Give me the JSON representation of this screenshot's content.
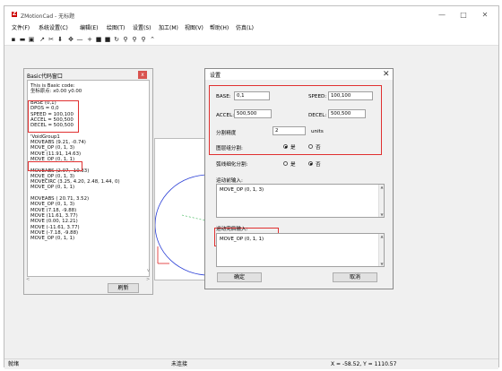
{
  "window": {
    "title": "ZMotionCad - 无标题",
    "minimize": "—",
    "maximize": "□",
    "close": "✕"
  },
  "menu": [
    "文件(F)",
    "系统设置(C)",
    "编辑(E)",
    "绘图(T)",
    "设置(S)",
    "加工(M)",
    "视图(V)",
    "帮助(H)",
    "仿真(L)"
  ],
  "toolbar_icons": [
    "new-file-icon",
    "open-folder-icon",
    "save-icon",
    "cursor-icon",
    "scissors-icon",
    "download-icon",
    "move-icon",
    "line-icon",
    "crosshair-icon",
    "lock-icon",
    "unlock-icon",
    "rotate-icon",
    "zoom-in-icon",
    "zoom-out-icon",
    "zoom-fit-icon",
    "pan-icon"
  ],
  "basic_panel": {
    "title": "Basic代码窗口",
    "close": "x",
    "lines": [
      "This is Basic code:",
      "坐标原点: x0.00 y0.00",
      "",
      "BASE (0,1)",
      "DPOS = 0,0",
      "SPEED = 100,100",
      "ACCEL = 500,500",
      "DECEL = 500,500",
      "",
      "'VoidGroup1",
      "MOVEABS (9.21, -0.74)",
      "MOVE_OP (0, 1, 3)",
      "MOVE (11.91, 14.63)",
      "MOVE_OP (0, 1, 1)",
      "",
      "MOVEABS (2.07, -10.33)",
      "MOVE_OP (0, 1, 3)",
      "MOVECIRC (3.25, 4.20, 2.48, 1.44, 0)",
      "MOVE_OP (0, 1, 1)",
      "",
      "MOVEABS ( 20.71, 3.52)",
      "MOVE_OP (0, 1, 3)",
      "MOVE (7.18, -9.88)",
      "MOVE (11.61, 3.77)",
      "MOVE (0.00, 12.21)",
      "MOVE (-11.61, 3.77)",
      "MOVE (-7.18, -9.88)",
      "MOVE_OP (0, 1, 1)"
    ],
    "button": "刷新"
  },
  "dialog": {
    "title": "设置",
    "close": "✕",
    "base_label": "BASE:",
    "base_value": "0,1",
    "speed_label": "SPEED:",
    "speed_value": "100,100",
    "accel_label": "ACCEL:",
    "accel_value": "500,500",
    "decel_label": "DECEL:",
    "decel_value": "500,500",
    "resolution_label": "分割精度",
    "resolution_value": "2",
    "resolution_unit": "units",
    "group1_label": "图层组分割:",
    "group1_yes": "是",
    "group1_no": "否",
    "group1_selected": "yes",
    "group2_label": "弧线细化分割:",
    "group2_yes": "是",
    "group2_no": "否",
    "group2_selected": "no",
    "start_label": "运动前输入:",
    "start_value": "MOVE_OP (0, 1, 3)",
    "end_label": "运动完后输入:",
    "end_value": "MOVE_OP (0, 1, 1)",
    "ok": "确定",
    "cancel": "取消"
  },
  "status": {
    "left": "就绪",
    "middle": "未连接",
    "coords": "X = -58.52, Y = 1110.57"
  },
  "colors": {
    "highlight_red": "#e03030",
    "arc_blue": "#2a3fd6",
    "axis_green": "#31b24d",
    "axis_red": "#d22"
  }
}
